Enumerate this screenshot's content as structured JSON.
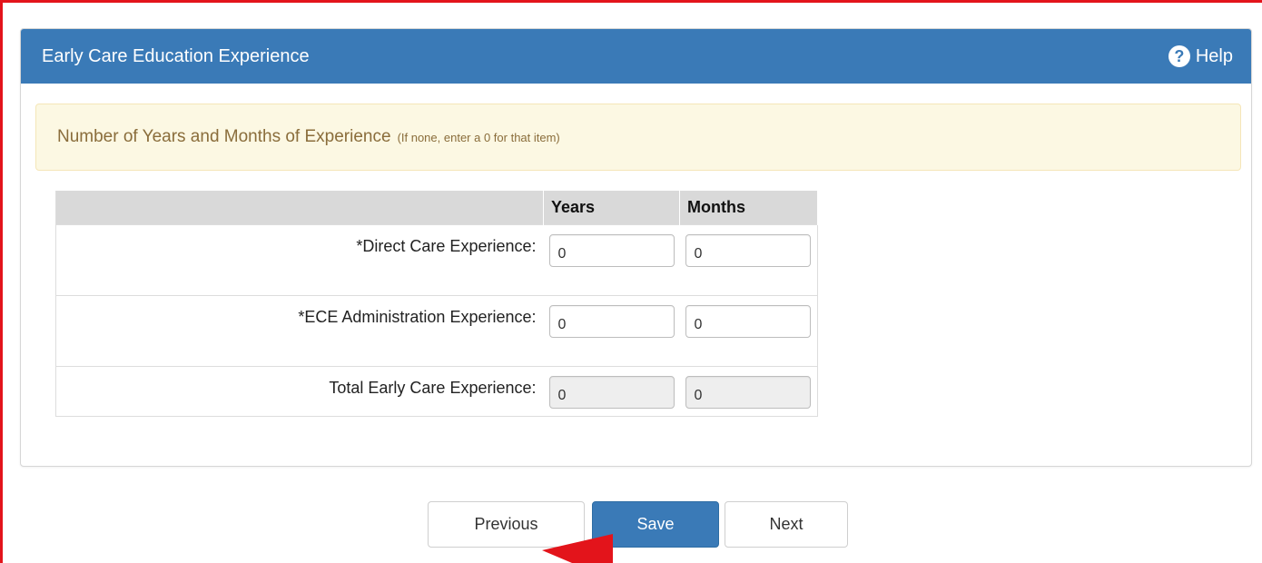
{
  "panel": {
    "title": "Early Care Education Experience",
    "help_label": "Help",
    "help_icon": "question-circle-icon"
  },
  "alert": {
    "main_text": "Number of Years and Months of Experience",
    "note_text": "(If none, enter a 0 for that item)"
  },
  "table": {
    "headers": [
      "",
      "Years",
      "Months"
    ],
    "rows": [
      {
        "label": "*Direct Care Experience:",
        "years": "0",
        "months": "0",
        "readonly": false
      },
      {
        "label": "*ECE Administration Experience:",
        "years": "0",
        "months": "0",
        "readonly": false
      },
      {
        "label": "Total Early Care Experience:",
        "years": "0",
        "months": "0",
        "readonly": true
      }
    ]
  },
  "buttons": {
    "previous": "Previous",
    "save": "Save",
    "next": "Next"
  },
  "colors": {
    "header_bg": "#3a7ab7",
    "alert_bg": "#fcf8e3",
    "alert_text": "#8a6d3b",
    "annotation_red": "#e3141b"
  }
}
